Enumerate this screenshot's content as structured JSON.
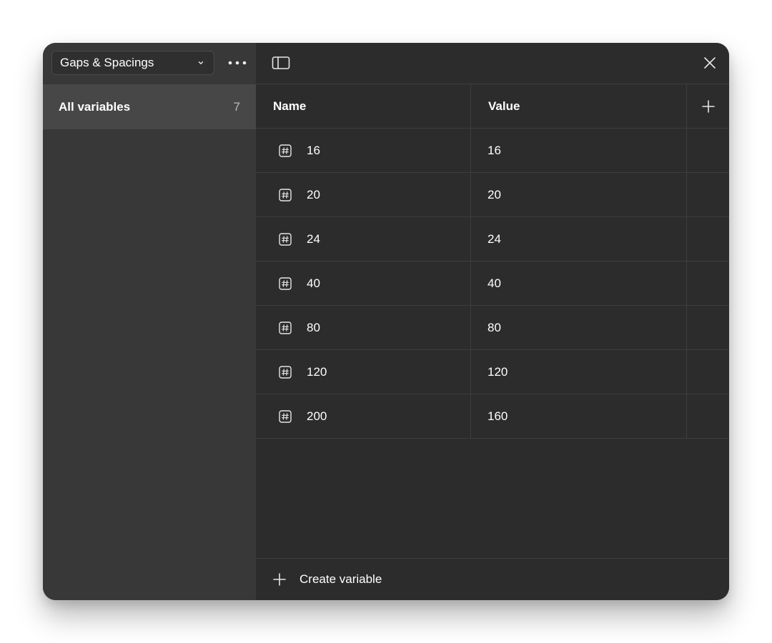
{
  "sidebar": {
    "collection": {
      "label": "Gaps & Spacings",
      "icon": "chevron-down-icon"
    },
    "more_icon": "more-horizontal-icon",
    "nav_items": [
      {
        "label": "All variables",
        "count": "7"
      }
    ]
  },
  "header": {
    "sidebar_toggle_icon": "sidebar-toggle-icon",
    "close_icon": "close-icon"
  },
  "table": {
    "columns": [
      {
        "label": "Name"
      },
      {
        "label": "Value"
      }
    ],
    "add_column_icon": "plus-icon",
    "rows": [
      {
        "name": "16",
        "value": "16",
        "type_icon": "number-variable-icon"
      },
      {
        "name": "20",
        "value": "20",
        "type_icon": "number-variable-icon"
      },
      {
        "name": "24",
        "value": "24",
        "type_icon": "number-variable-icon"
      },
      {
        "name": "40",
        "value": "40",
        "type_icon": "number-variable-icon"
      },
      {
        "name": "80",
        "value": "80",
        "type_icon": "number-variable-icon"
      },
      {
        "name": "120",
        "value": "120",
        "type_icon": "number-variable-icon"
      },
      {
        "name": "200",
        "value": "160",
        "type_icon": "number-variable-icon"
      }
    ]
  },
  "footer": {
    "create_label": "Create variable",
    "create_icon": "plus-icon"
  },
  "colors": {
    "panel_bg": "#2c2c2c",
    "sidebar_bg": "#383838",
    "selected_bg": "#474747",
    "divider": "#3d3d3d",
    "text_primary": "#ffffff",
    "text_secondary": "#b8b8b8"
  }
}
